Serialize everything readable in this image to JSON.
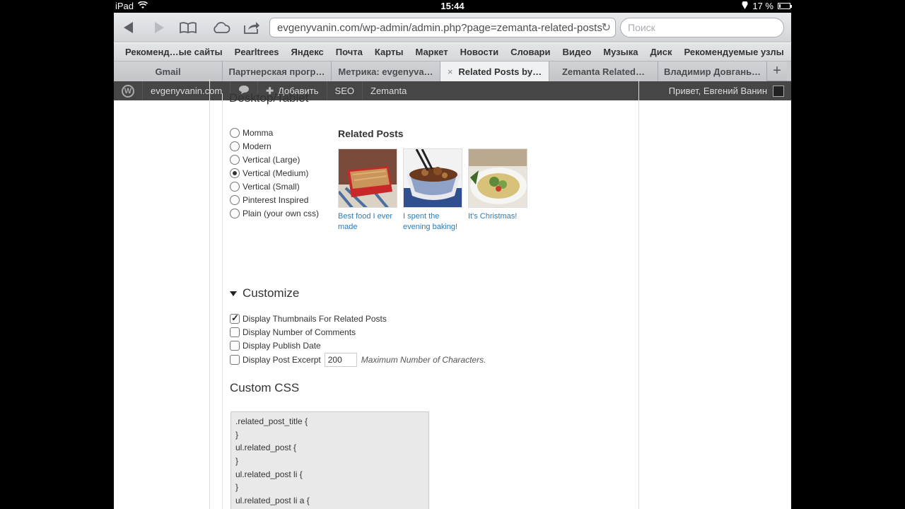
{
  "status": {
    "device": "iPad",
    "time": "15:44",
    "battery": "17 %",
    "battery_level": 0.17
  },
  "browser": {
    "url": "evgenyvanin.com/wp-admin/admin.php?page=zemanta-related-posts",
    "search_placeholder": "Поиск",
    "bookmarks": [
      "Рекоменд…ые сайты",
      "Pearltrees",
      "Яндекс",
      "Почта",
      "Карты",
      "Маркет",
      "Новости",
      "Словари",
      "Видео",
      "Музыка",
      "Диск",
      "Рекомендуемые узлы"
    ],
    "tabs": [
      "Gmail",
      "Партнерская прогр…",
      "Метрика: evgenyva…",
      "Related Posts by…",
      "Zemanta Related…",
      "Владимир Довгань…"
    ],
    "active_tab_close": "×",
    "new_tab": "+"
  },
  "adminbar": {
    "site": "evgenyvanin.com",
    "add": "Добавить",
    "seo": "SEO",
    "zemanta": "Zemanta",
    "greeting": "Привет, Евгений Ванин"
  },
  "page": {
    "section_partial": "Desktop/Tablet",
    "styles": [
      "Momma",
      "Modern",
      "Vertical (Large)",
      "Vertical (Medium)",
      "Vertical (Small)",
      "Pinterest Inspired",
      "Plain (your own css)"
    ],
    "selected_style": "Vertical (Medium)",
    "related_title": "Related Posts",
    "thumbs": [
      {
        "caption": "Best food I ever made"
      },
      {
        "caption": "I spent the evening baking!"
      },
      {
        "caption": "It's Christmas!"
      }
    ],
    "customize_title": "Customize",
    "options": [
      {
        "label": "Display Thumbnails For Related Posts",
        "checked": true
      },
      {
        "label": "Display Number of Comments",
        "checked": false
      },
      {
        "label": "Display Publish Date",
        "checked": false
      },
      {
        "label": "Display Post Excerpt",
        "checked": false
      }
    ],
    "excerpt_value": "200",
    "excerpt_hint": "Maximum Number of Characters.",
    "custom_css_title": "Custom CSS",
    "css_lines": [
      ".related_post_title {",
      "}",
      "ul.related_post {",
      "}",
      "ul.related_post li {",
      "}",
      "ul.related_post li a {"
    ]
  }
}
